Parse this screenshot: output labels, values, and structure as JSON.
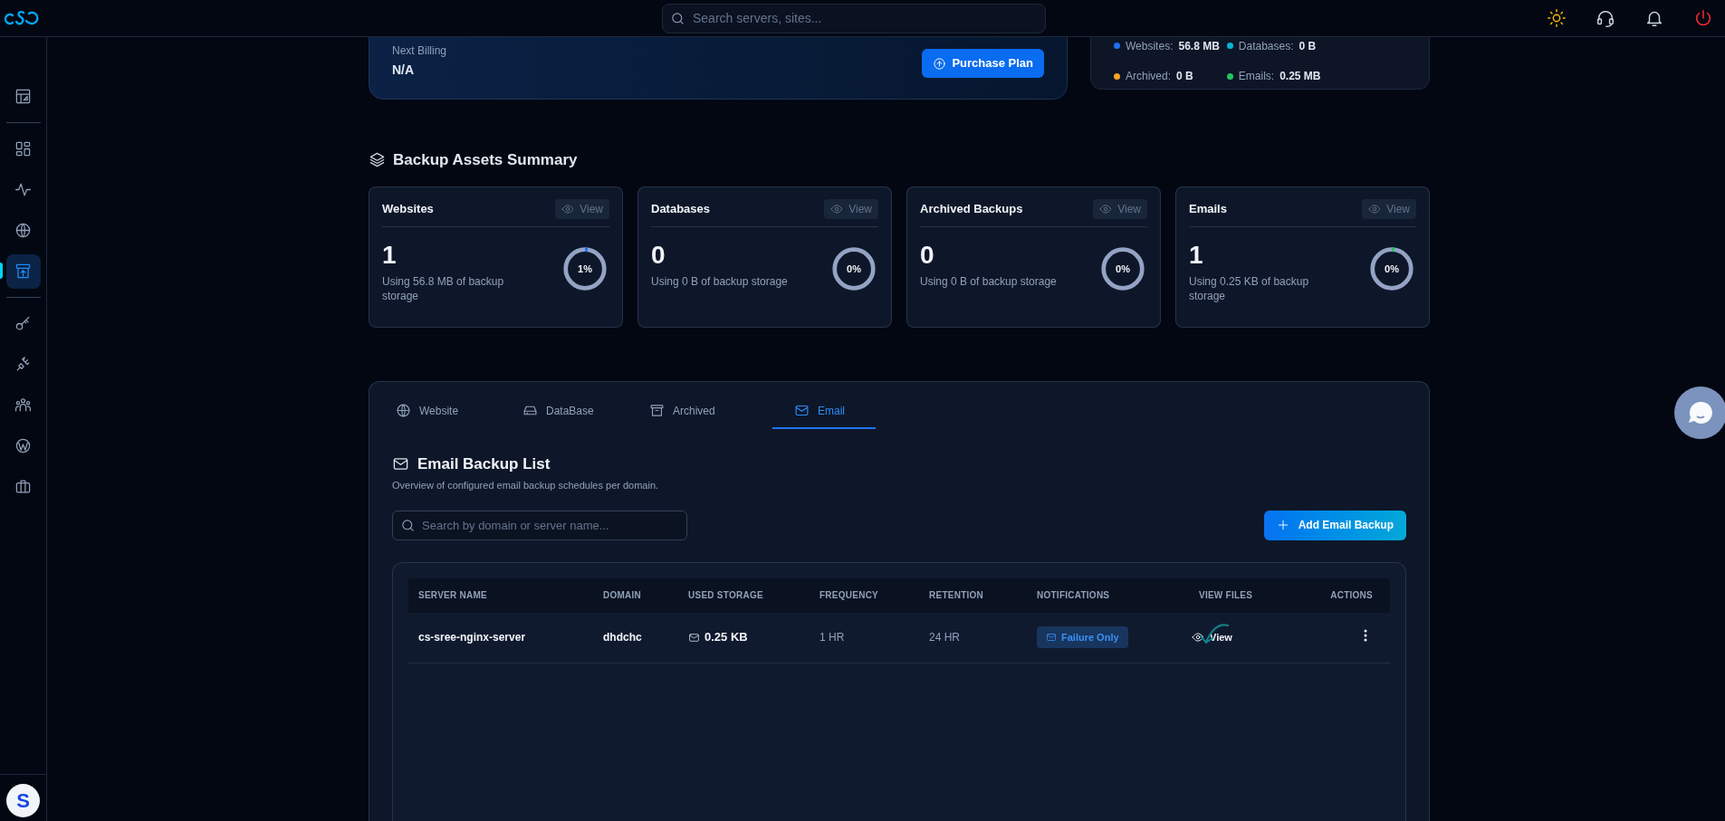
{
  "topbar": {
    "search": {
      "placeholder": "Search servers, sites..."
    }
  },
  "sidebar": {
    "items": [
      {
        "selected": false
      },
      {
        "selected": false
      },
      {
        "selected": false
      },
      {
        "selected": false
      },
      {
        "selected": true
      },
      {
        "selected": false
      },
      {
        "selected": false
      },
      {
        "selected": false
      },
      {
        "selected": false
      },
      {
        "selected": false
      }
    ],
    "avatar": "S"
  },
  "plan": {
    "label": "Next Billing",
    "value": "N/A",
    "button": "Purchase Plan"
  },
  "storage_legend": [
    {
      "label": "Websites:",
      "value": "56.8 MB",
      "color": "#1d72f2"
    },
    {
      "label": "Databases:",
      "value": "0 B",
      "color": "#06b6d4"
    },
    {
      "label": "Archived:",
      "value": "0 B",
      "color": "#f5a524"
    },
    {
      "label": "Emails:",
      "value": "0.25 MB",
      "color": "#22c55e"
    }
  ],
  "summary": {
    "title": "Backup Assets Summary",
    "cards": [
      {
        "title": "Websites",
        "view": "View",
        "count": "1",
        "caption": "Using 56.8 MB of backup storage",
        "percent": "1%",
        "level": 0.01,
        "color": "#1d72f2"
      },
      {
        "title": "Databases",
        "view": "View",
        "count": "0",
        "caption": "Using 0 B of backup storage",
        "percent": "0%"
      },
      {
        "title": "Archived Backups",
        "view": "View",
        "count": "0",
        "caption": "Using 0 B of backup storage",
        "percent": "0%"
      },
      {
        "title": "Emails",
        "view": "View",
        "count": "1",
        "caption": "Using 0.25 KB of backup storage",
        "percent": "0%",
        "level": 0.01,
        "color": "#22c55e"
      }
    ]
  },
  "tabs": [
    {
      "label": "Website",
      "selected": false
    },
    {
      "label": "DataBase",
      "selected": false
    },
    {
      "label": "Archived",
      "selected": false
    },
    {
      "label": "Email",
      "selected": true
    }
  ],
  "list": {
    "title": "Email Backup List",
    "subtitle": "Overview of configured email backup schedules per domain.",
    "search": {
      "placeholder": "Search by domain or server name..."
    },
    "add_button": "Add Email Backup"
  },
  "table": {
    "columns": [
      "SERVER NAME",
      "DOMAIN",
      "USED STORAGE",
      "FREQUENCY",
      "RETENTION",
      "NOTIFICATIONS",
      "VIEW FILES",
      "ACTIONS"
    ],
    "rows": [
      {
        "server": "cs-sree-nginx-server",
        "domain": "dhdchc",
        "storage": "0.25 KB",
        "frequency": "1 HR",
        "retention": "24 HR",
        "notification": "Failure Only",
        "view": "View"
      }
    ]
  }
}
